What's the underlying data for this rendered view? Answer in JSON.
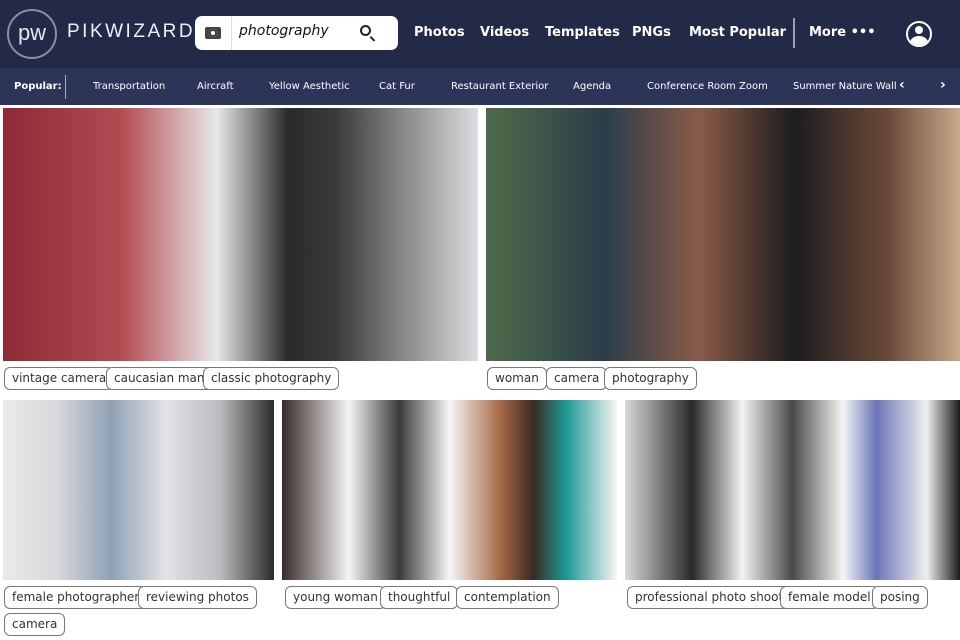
{
  "header": {
    "logo": "pw",
    "brand": "PIKWIZARD",
    "search_value": "photography",
    "nav": [
      "Photos",
      "Videos",
      "Templates",
      "PNGs",
      "Most Popular"
    ],
    "more": "More •••"
  },
  "popular": {
    "label": "Popular:",
    "items": [
      "Transportation",
      "Aircraft",
      "Yellow Aesthetic",
      "Cat Fur",
      "Restaurant Exterior",
      "Agenda",
      "Conference Room Zoom",
      "Summer Nature Wall"
    ],
    "prev": "‹",
    "next": "›"
  },
  "images": [
    {
      "tags": [
        "vintage camera",
        "caucasian man",
        "classic photography"
      ]
    },
    {
      "tags": [
        "woman",
        "camera",
        "photography"
      ]
    },
    {
      "tags": [
        "female photographer",
        "reviewing photos",
        "camera"
      ]
    },
    {
      "tags": [
        "young woman",
        "thoughtful",
        "contemplation"
      ]
    },
    {
      "tags": [
        "professional photo shoot",
        "female model",
        "posing"
      ]
    }
  ]
}
